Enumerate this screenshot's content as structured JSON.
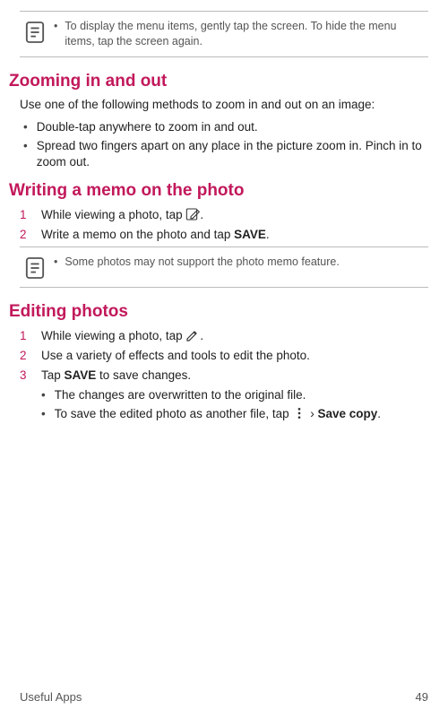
{
  "note1": {
    "text": "To display the menu items, gently tap the screen. To hide the menu items, tap the screen again."
  },
  "zoom": {
    "heading": "Zooming in and out",
    "intro": "Use one of the following methods to zoom in and out on an image:",
    "b1": "Double-tap anywhere to zoom in and out.",
    "b2": "Spread two fingers apart on any place in the picture zoom in. Pinch in to zoom out."
  },
  "memo": {
    "heading": "Writing a memo on the photo",
    "s1a": "While viewing a photo, tap ",
    "s1b": ".",
    "s2a": "Write a memo on the photo and tap ",
    "s2save": "SAVE",
    "s2b": ".",
    "num1": "1",
    "num2": "2"
  },
  "note2": {
    "text": "Some photos may not support the photo memo feature."
  },
  "edit": {
    "heading": "Editing photos",
    "num1": "1",
    "num2": "2",
    "num3": "3",
    "s1a": "While viewing a photo, tap ",
    "s1b": ".",
    "s2": "Use a variety of effects and tools to edit the photo.",
    "s3a": "Tap ",
    "s3save": "SAVE",
    "s3b": " to save changes.",
    "sub1": "The changes are overwritten to the original file.",
    "sub2a": "To save the edited photo as another file, tap ",
    "sub2chev": " ",
    "sub2save": "Save copy",
    "sub2b": "."
  },
  "footer": {
    "left": "Useful Apps",
    "right": "49"
  },
  "glyphs": {
    "dot": "•",
    "chevron": "›"
  }
}
